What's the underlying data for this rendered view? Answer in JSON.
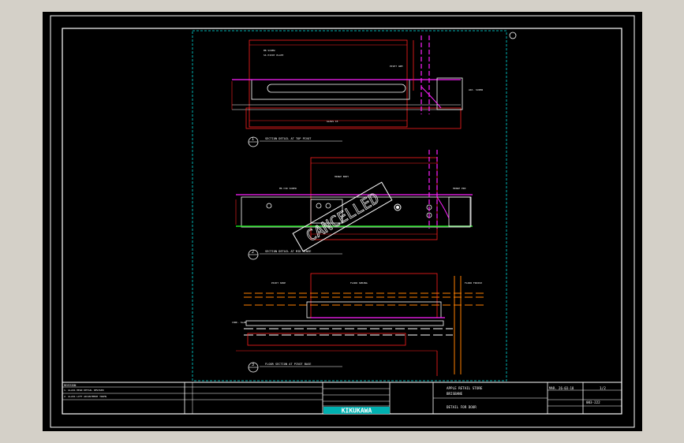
{
  "drawing": {
    "stamp": "CANCELLED",
    "company_logo": "KIKUKAWA",
    "title_block": {
      "project": "APPLE RETAIL STORE",
      "location": "BRISBANE",
      "drawing_title": "DETAIL FOR DOOR",
      "date": "MAR. 26-03-18",
      "sheet": "1/2",
      "drawing_no": "003-222"
    },
    "revision_header": "REVISION",
    "revision_rows": [
      "1. GLASS HEAD DETAIL REVISED",
      "2. GLASS LIFT ADJUSTMENT TRIMS"
    ],
    "views": [
      {
        "number": "1",
        "caption": "SECTION DETAIL AT TOP PIVOT"
      },
      {
        "number": "2",
        "caption": "SECTION DETAIL AT MID HINGE"
      },
      {
        "number": "3",
        "caption": "FLOOR SECTION AT PIVOT BASE"
      }
    ]
  },
  "colors": {
    "frame": "#ffffff",
    "border": "#00b0b0",
    "geometry": "#ff2020",
    "hidden": "#ff20ff",
    "annotation": "#ffffff",
    "floor": "#20e020",
    "fill": "#ff8000",
    "stamp": "#ffffff"
  }
}
